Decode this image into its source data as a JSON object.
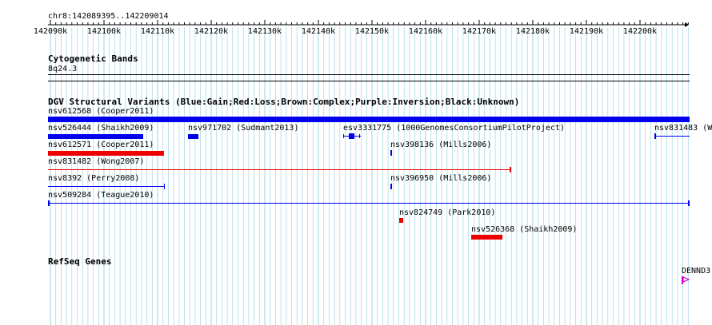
{
  "ruler": {
    "position_label": "chr8:142089395..142209014",
    "ticks": [
      "142090k",
      "142100k",
      "142110k",
      "142120k",
      "142130k",
      "142140k",
      "142150k",
      "142160k",
      "142170k",
      "142180k",
      "142190k",
      "142200k"
    ]
  },
  "tracks": {
    "cytoband": {
      "title": "Cytogenetic Bands",
      "band_label": "8q24.3"
    },
    "dgv": {
      "title": "DGV Structural Variants (Blue:Gain;Red:Loss;Brown:Complex;Purple:Inversion;Black:Unknown)",
      "features": [
        {
          "label": "nsv612568 (Cooper2011)",
          "color": "#0000ee"
        },
        {
          "label": "nsv526444 (Shaikh2009)",
          "color": "#0000ee"
        },
        {
          "label": "nsv971702 (Sudmant2013)",
          "color": "#0000ee"
        },
        {
          "label": "esv3331775 (1000GenomesConsortiumPilotProject)",
          "color": "#0000ee"
        },
        {
          "label": "nsv831483 (W",
          "color": "#0000ee"
        },
        {
          "label": "nsv612571 (Cooper2011)",
          "color": "#ee0000"
        },
        {
          "label": "nsv398136 (Mills2006)",
          "color": "#0000ee"
        },
        {
          "label": "nsv831482 (Wong2007)",
          "color": "#ee0000"
        },
        {
          "label": "nsv8392 (Perry2008)",
          "color": "#0000ee"
        },
        {
          "label": "nsv396950 (Mills2006)",
          "color": "#0000ee"
        },
        {
          "label": "nsv509284 (Teague2010)",
          "color": "#0000ee"
        },
        {
          "label": "nsv824749 (Park2010)",
          "color": "#ee0000"
        },
        {
          "label": "nsv526368 (Shaikh2009)",
          "color": "#ee0000"
        }
      ]
    },
    "refseq": {
      "title": "RefSeq Genes",
      "gene_label": "DENND3",
      "gene_color": "#cc00cc"
    }
  },
  "colors": {
    "gridline": "#a8dbe8",
    "gain": "#0000ee",
    "loss": "#ee0000",
    "axis": "#000000"
  }
}
